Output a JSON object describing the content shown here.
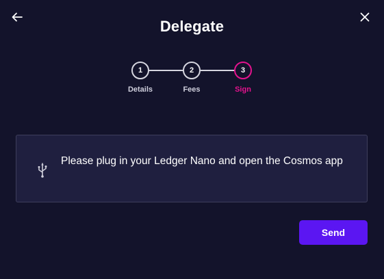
{
  "header": {
    "title": "Delegate",
    "back_icon": "arrow-left-icon",
    "close_icon": "close-icon"
  },
  "stepper": {
    "steps": [
      {
        "number": "1",
        "label": "Details",
        "state": "completed"
      },
      {
        "number": "2",
        "label": "Fees",
        "state": "completed"
      },
      {
        "number": "3",
        "label": "Sign",
        "state": "active"
      }
    ],
    "active_color": "#e4138e"
  },
  "notice": {
    "icon": "usb-icon",
    "text": "Please plug in your Ledger Nano and open the Cosmos app"
  },
  "footer": {
    "send_label": "Send",
    "accent_color": "#5b16f2"
  }
}
